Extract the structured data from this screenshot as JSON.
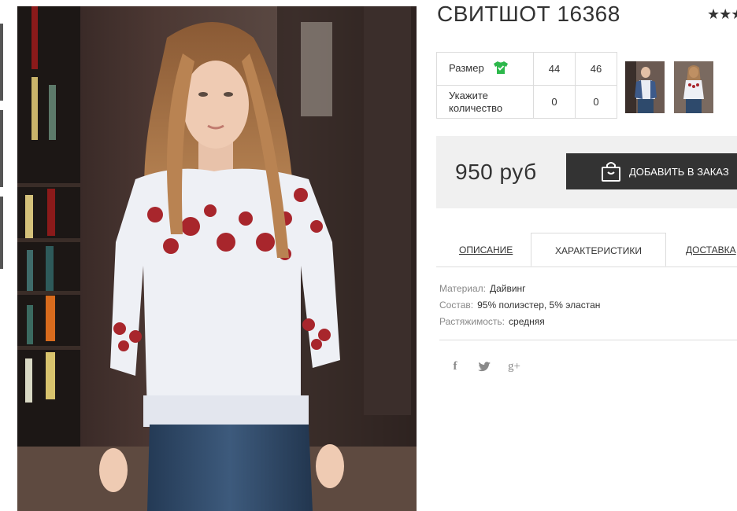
{
  "product": {
    "title": "СВИТШОТ 16368",
    "rating_stars": "★★★"
  },
  "sizes": {
    "size_label": "Размер",
    "quantity_label": "Укажите количество",
    "columns": [
      "44",
      "46"
    ],
    "quantities": [
      "0",
      "0"
    ]
  },
  "price": {
    "value": "950 руб",
    "add_button": "ДОБАВИТЬ В ЗАКАЗ"
  },
  "tabs": [
    {
      "label": "ОПИСАНИЕ",
      "active": false
    },
    {
      "label": "ХАРАКТЕРИСТИКИ",
      "active": true
    },
    {
      "label": "ДОСТАВКА",
      "active": false
    }
  ],
  "specs": [
    {
      "key": "Материал:",
      "value": "Дайвинг"
    },
    {
      "key": "Состав:",
      "value": "95% полиэстер, 5% эластан"
    },
    {
      "key": "Растяжимость:",
      "value": "средняя"
    }
  ],
  "social": {
    "facebook": "f",
    "twitter": "twitter-icon",
    "google": "g+"
  },
  "colors": {
    "accent_dark": "#333333",
    "price_bg": "#f0f0f0",
    "size_icon": "#2db84b"
  }
}
